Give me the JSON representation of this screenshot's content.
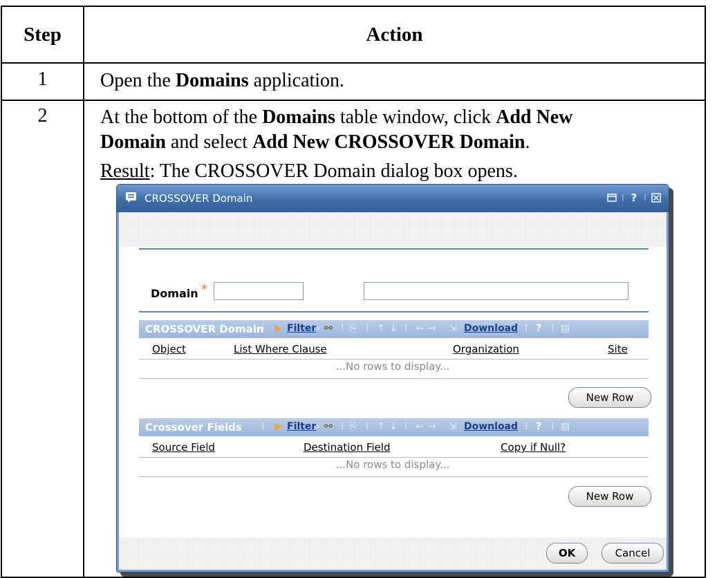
{
  "table": {
    "header_step": "Step",
    "header_action": "Action",
    "rows": [
      {
        "step": "1",
        "text_pre": "Open the ",
        "text_bold": "Domains",
        "text_post": " application."
      },
      {
        "step": "2",
        "line1_pre": "At the bottom of the ",
        "line1_bold1": "Domains",
        "line1_mid": " table window, click ",
        "line1_bold2": "Add New",
        "line2_bold1": "Domain",
        "line2_mid": " and select ",
        "line2_bold2": "Add New CROSSOVER Domain",
        "line2_post": ".",
        "result_label": "Result",
        "result_text": ": The CROSSOVER Domain dialog box opens."
      }
    ]
  },
  "dialog": {
    "title": "CROSSOVER Domain",
    "help_glyph": "?",
    "domain_label": "Domain",
    "required_marker": "*",
    "grid1": {
      "title": "CROSSOVER Domain",
      "filter_label": "Filter",
      "download_label": "Download",
      "help_glyph": "?",
      "columns": [
        "Object",
        "List Where Clause",
        "Organization",
        "Site"
      ],
      "empty_text": "...No rows to display...",
      "new_row_label": "New Row"
    },
    "grid2": {
      "title": "Crossover Fields",
      "filter_label": "Filter",
      "download_label": "Download",
      "help_glyph": "?",
      "columns": [
        "Source Field",
        "Destination Field",
        "Copy if Null?"
      ],
      "empty_text": "...No rows to display...",
      "new_row_label": "New Row"
    },
    "ok_label": "OK",
    "cancel_label": "Cancel"
  }
}
